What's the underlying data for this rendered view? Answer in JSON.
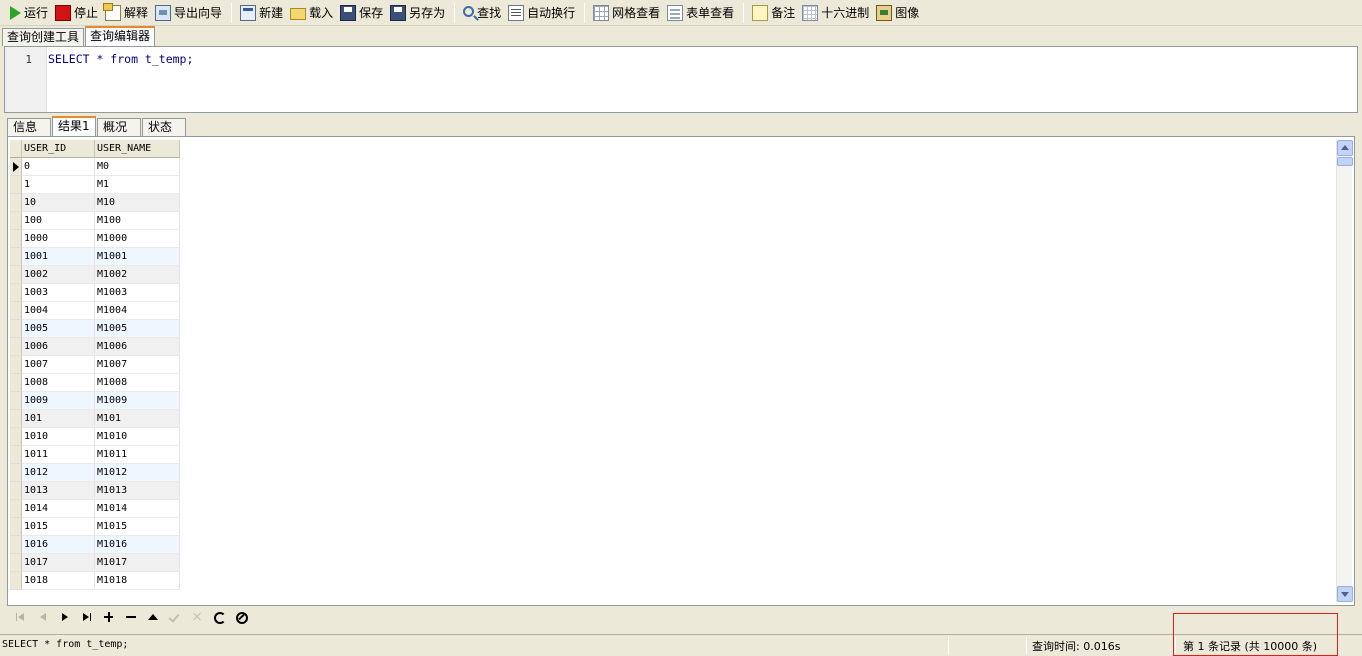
{
  "toolbar": {
    "run": "运行",
    "stop": "停止",
    "explain": "解释",
    "export_wizard": "导出向导",
    "new": "新建",
    "load": "载入",
    "save": "保存",
    "save_as": "另存为",
    "find": "查找",
    "word_wrap": "自动换行",
    "grid_view": "网格查看",
    "form_view": "表单查看",
    "memo": "备注",
    "hex": "十六进制",
    "image": "图像"
  },
  "editor_tabs": [
    "查询创建工具",
    "查询编辑器"
  ],
  "editor": {
    "line_number": "1",
    "sql": "SELECT * from t_temp;"
  },
  "result_tabs": [
    "信息",
    "结果1",
    "概况",
    "状态"
  ],
  "grid": {
    "columns": [
      "USER_ID",
      "USER_NAME"
    ],
    "rows": [
      [
        "0",
        "M0"
      ],
      [
        "1",
        "M1"
      ],
      [
        "10",
        "M10"
      ],
      [
        "100",
        "M100"
      ],
      [
        "1000",
        "M1000"
      ],
      [
        "1001",
        "M1001"
      ],
      [
        "1002",
        "M1002"
      ],
      [
        "1003",
        "M1003"
      ],
      [
        "1004",
        "M1004"
      ],
      [
        "1005",
        "M1005"
      ],
      [
        "1006",
        "M1006"
      ],
      [
        "1007",
        "M1007"
      ],
      [
        "1008",
        "M1008"
      ],
      [
        "1009",
        "M1009"
      ],
      [
        "101",
        "M101"
      ],
      [
        "1010",
        "M1010"
      ],
      [
        "1011",
        "M1011"
      ],
      [
        "1012",
        "M1012"
      ],
      [
        "1013",
        "M1013"
      ],
      [
        "1014",
        "M1014"
      ],
      [
        "1015",
        "M1015"
      ],
      [
        "1016",
        "M1016"
      ],
      [
        "1017",
        "M1017"
      ],
      [
        "1018",
        "M1018"
      ]
    ]
  },
  "statusbar": {
    "sql": "SELECT * from t_temp;",
    "query_time": "查询时间: 0.016s",
    "record_info": "第 1 条记录 (共 10000 条)"
  }
}
